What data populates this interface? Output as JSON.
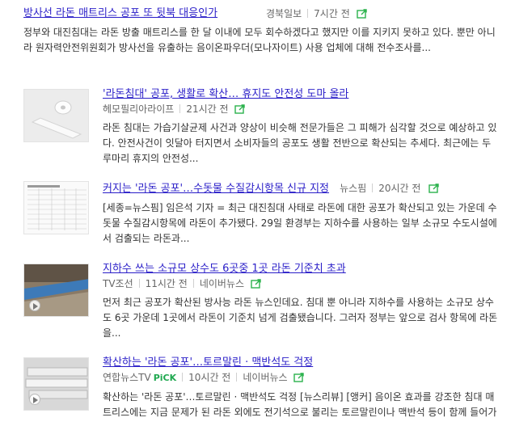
{
  "items": [
    {
      "title": "방사선 라돈 매트리스 공포 또 뒷북 대응인가",
      "source": "경북일보",
      "time": "7시간 전",
      "desc": "정부와 대진침대는 라돈 방출 매트리스를 한 달 이내에 모두 회수하겠다고 했지만 이를 지키지 못하고 있다. 뿐만 아니라 원자력안전위원회가 방사선을 유출하는 음이온파우더(모나자이트) 사용 업체에 대해 전수조사를..."
    },
    {
      "title": "'라돈침대' 공포, 생활로 확산… 휴지도 안전성 도마 올라",
      "source": "헤모필리아라이프",
      "time": "21시간 전",
      "desc": "라돈 침대는 가습기살균제 사건과 양상이 비슷해 전문가들은 그 피해가 심각할 것으로 예상하고 있다. 안전사건이 잇달아 터지면서 소비자들의 공포도 생활 전반으로 확산되는 추세다. 최근에는 두루마리 휴지의 안전성..."
    },
    {
      "title": "커지는 '라돈 공포'…수돗물 수질감시항목 신규 지정",
      "source": "뉴스핌",
      "time": "20시간 전",
      "desc": "[세종=뉴스핌] 임은석 기자 = 최근 대진침대 사태로 라돈에 대한 공포가 확산되고 있는 가운데 수돗물 수질감시항목에 라돈이 추가됐다. 29일 환경부는 지하수를 사용하는 일부 소규모 수도시설에서 검출되는 라돈과..."
    },
    {
      "title": "지하수 쓰는 소규모 상수도 6곳중 1곳 라돈 기준치 초과",
      "source": "TV조선",
      "time": "11시간 전",
      "platform": "네이버뉴스",
      "desc": "먼저 최근 공포가 확산된 방사능 라돈 뉴스인데요. 침대 뿐 아니라 지하수를 사용하는 소규모 상수도 6곳 가운데 1곳에서 라돈이 기준치 넘게 검출됐습니다. 그러자 정부는 앞으로 검사 항목에 라돈을..."
    },
    {
      "title": "확산하는 '라돈 공포'…토르말린 · 맥반석도 걱정",
      "source": "연합뉴스TV",
      "pick": "PiCK",
      "time": "10시간 전",
      "platform": "네이버뉴스",
      "desc": "확산하는 '라돈 공포'…토르말린 · 맥반석도 걱정 [뉴스리뷰] [앵커] 음이온 효과를 강조한 침대 매트리스에는 지금 문제가 된 라돈 외에도 전기석으로 불리는 토르말린이나 맥반석 등이 함께 들어가 사용된 경우도..."
    }
  ]
}
